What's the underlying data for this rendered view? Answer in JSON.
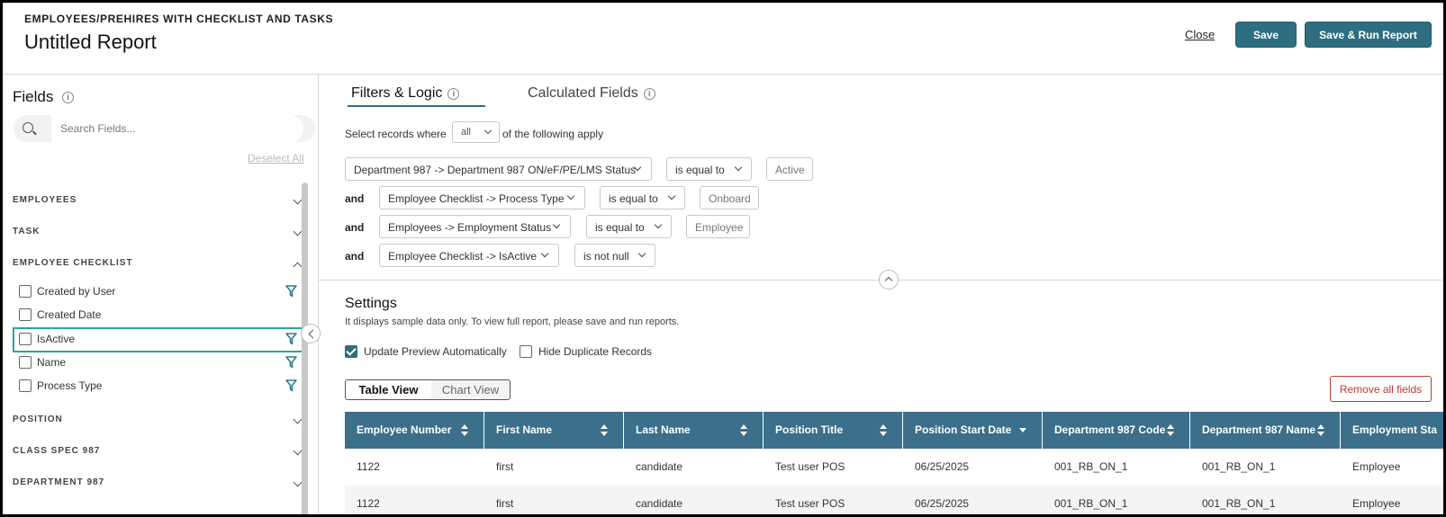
{
  "header": {
    "kicker": "EMPLOYEES/PREHIRES WITH CHECKLIST AND TASKS",
    "title": "Untitled Report",
    "close_label": "Close",
    "save_label": "Save",
    "save_run_label": "Save & Run Report"
  },
  "colors": {
    "primary": "#2e6e80",
    "table_header": "#3b6f8c",
    "highlight": "#2aa59a",
    "danger": "#c0392b"
  },
  "fields_panel": {
    "title": "Fields",
    "search_placeholder": "Search Fields...",
    "deselect_all": "Deselect All",
    "sections": [
      {
        "label": "EMPLOYEES",
        "state": "collapsed"
      },
      {
        "label": "TASK",
        "state": "collapsed"
      },
      {
        "label": "EMPLOYEE CHECKLIST",
        "state": "expanded"
      },
      {
        "label": "POSITION",
        "state": "collapsed"
      },
      {
        "label": "CLASS SPEC 987",
        "state": "collapsed"
      },
      {
        "label": "DEPARTMENT 987",
        "state": "collapsed"
      }
    ],
    "checklist_items": [
      {
        "label": "Created by User",
        "has_filter": true
      },
      {
        "label": "Created Date",
        "has_filter": false
      },
      {
        "label": "IsActive",
        "has_filter": true,
        "highlighted": true
      },
      {
        "label": "Name",
        "has_filter": true
      },
      {
        "label": "Process Type",
        "has_filter": true
      }
    ]
  },
  "tabs": {
    "filters": "Filters & Logic",
    "calculated": "Calculated Fields"
  },
  "filters": {
    "select_records_label": "Select records where",
    "match_mode": "all",
    "following_label": "of the following apply",
    "conditions": [
      {
        "conjunction": "",
        "field": "Department 987 -> Department 987 ON/eF/PE/LMS Status",
        "operator": "is equal to",
        "value": "Active"
      },
      {
        "conjunction": "and",
        "field": "Employee Checklist -> Process Type",
        "operator": "is equal to",
        "value": "Onboard"
      },
      {
        "conjunction": "and",
        "field": "Employees -> Employment Status",
        "operator": "is equal to",
        "value": "Employee"
      },
      {
        "conjunction": "and",
        "field": "Employee Checklist -> IsActive",
        "operator": "is not null",
        "value": ""
      }
    ]
  },
  "settings": {
    "title": "Settings",
    "note": "It displays sample data only. To view full report, please save and run reports.",
    "update_preview_label": "Update Preview Automatically",
    "update_preview_checked": true,
    "hide_duplicates_label": "Hide Duplicate Records",
    "hide_duplicates_checked": false
  },
  "views": {
    "table": "Table View",
    "chart": "Chart View",
    "remove_all": "Remove all fields"
  },
  "table": {
    "columns": [
      "Employee Number",
      "First Name",
      "Last Name",
      "Position Title",
      "Position Start Date",
      "Department 987 Code",
      "Department 987 Name",
      "Employment Sta"
    ],
    "rows": [
      [
        "1122",
        "first",
        "candidate",
        "Test user POS",
        "06/25/2025",
        "001_RB_ON_1",
        "001_RB_ON_1",
        "Employee"
      ],
      [
        "1122",
        "first",
        "candidate",
        "Test user POS",
        "06/25/2025",
        "001_RB_ON_1",
        "001_RB_ON_1",
        "Employee"
      ]
    ]
  }
}
